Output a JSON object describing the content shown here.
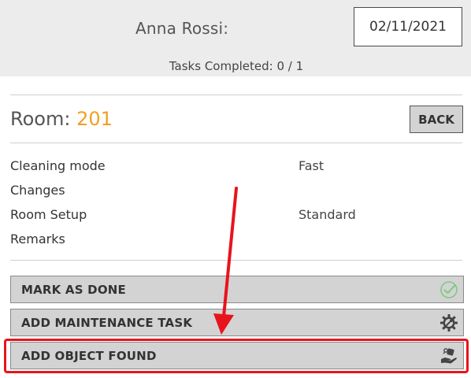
{
  "header": {
    "user_name": "Anna Rossi:",
    "date": "02/11/2021",
    "tasks_completed": "Tasks Completed: 0 / 1"
  },
  "room": {
    "label": "Room:",
    "number": "201",
    "back_label": "BACK"
  },
  "details": [
    {
      "label": "Cleaning mode",
      "value": "Fast"
    },
    {
      "label": "Changes",
      "value": ""
    },
    {
      "label": "Room Setup",
      "value": "Standard"
    },
    {
      "label": "Remarks",
      "value": ""
    }
  ],
  "actions": {
    "mark_done": {
      "label": "MARK AS DONE",
      "icon": "check-circle-icon"
    },
    "add_maintenance": {
      "label": "ADD MAINTENANCE TASK",
      "icon": "gear-wrench-icon"
    },
    "add_object_found": {
      "label": "ADD OBJECT FOUND",
      "icon": "hand-object-icon"
    }
  },
  "colors": {
    "header_bg": "#ececec",
    "room_number": "#f0a020",
    "button_bg": "#d3d3d3",
    "annotation_red": "#e8141c",
    "check_green": "#7ecb7e"
  }
}
